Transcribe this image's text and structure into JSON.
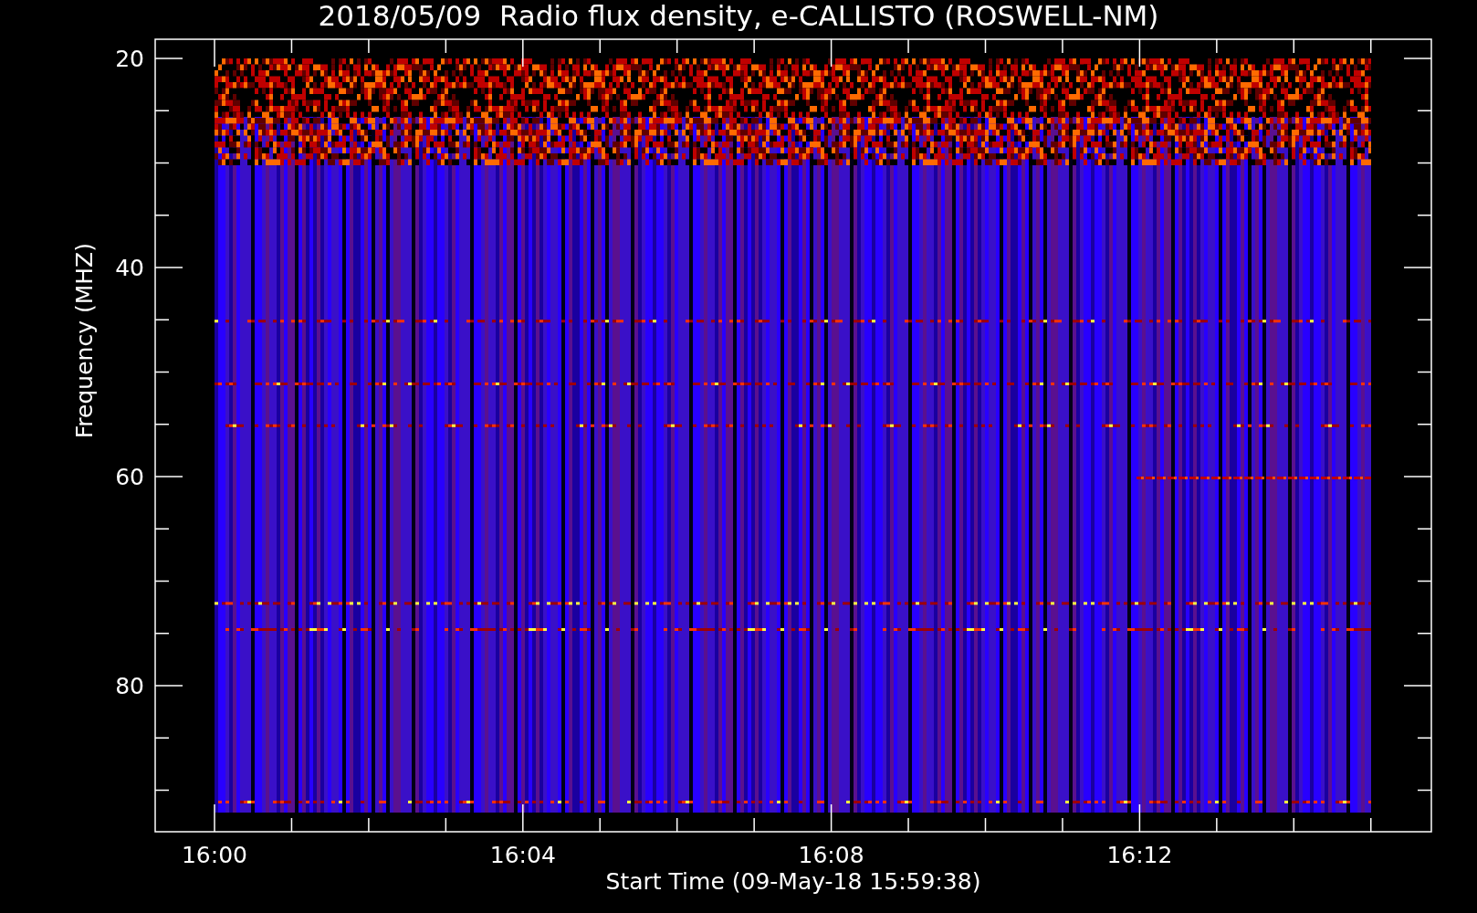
{
  "title": "2018/05/09  Radio flux density, e-CALLISTO (ROSWELL-NM)",
  "y_axis": {
    "label": "Frequency (MHZ)",
    "ticks": [
      "20",
      "40",
      "60",
      "80"
    ]
  },
  "x_axis": {
    "label": "Start Time (09-May-18 15:59:38)",
    "ticks": [
      "16:00",
      "16:04",
      "16:08",
      "16:12"
    ]
  }
}
